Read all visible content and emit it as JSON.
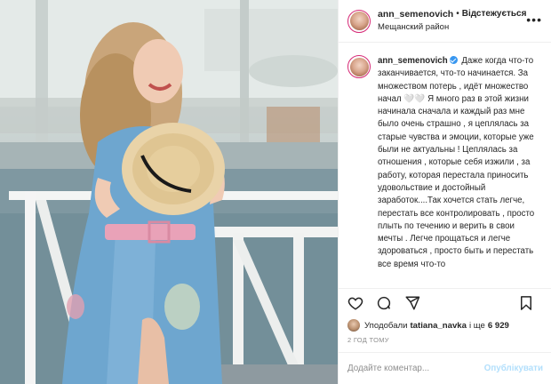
{
  "header": {
    "username": "ann_semenovich",
    "separator": "•",
    "follow_label": "Відстежується",
    "location": "Мещанский район",
    "more_icon": "more-horizontal-icon"
  },
  "caption": {
    "username": "ann_semenovich",
    "text": "Даже когда что-то заканчивается, что-то начинается. За множеством потерь , идёт множество начал 🤍🤍 Я много раз в этой жизни начинала сначала и каждый раз мне было очень страшно , я цеплялась за старые чувства и эмоции, которые уже были не актуальны ! Цеплялась за отношения , которые себя изжили , за работу, которая перестала приносить удовольствие и достойный заработок....Так хочется стать легче, перестать все контролировать , просто плыть по течению и верить в свои мечты . Легче прощаться и легче здороваться , просто быть и перестать все время что-то"
  },
  "actions": {
    "like_icon": "heart-icon",
    "comment_icon": "comment-icon",
    "share_icon": "send-icon",
    "save_icon": "bookmark-icon"
  },
  "likes": {
    "prefix": "Уподобали",
    "liker": "tatiana_navka",
    "middle": "і ще",
    "count": "6 929"
  },
  "timestamp": "2 ГОД ТОМУ",
  "comment": {
    "placeholder": "Додайте коментар...",
    "publish_label": "Опублікувати"
  },
  "colors": {
    "accent": "#3897f0",
    "publish_disabled": "#b2dffc",
    "story_ring": "#d62976"
  }
}
